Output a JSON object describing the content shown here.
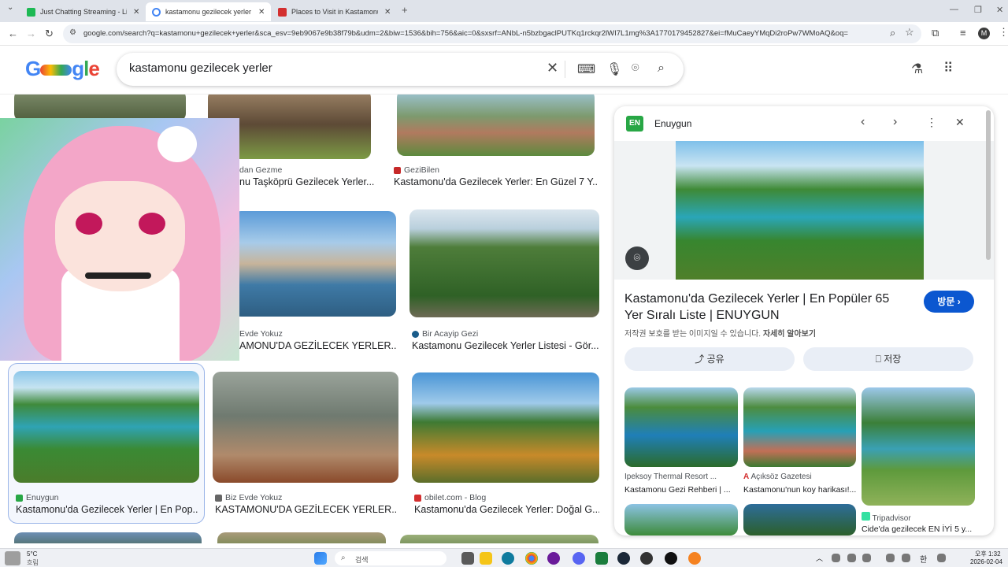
{
  "browser": {
    "tabs": [
      {
        "title": "Just Chatting Streaming - Live",
        "active": false,
        "color": "#1db954"
      },
      {
        "title": "kastamonu gezilecek yerler - Google",
        "active": true,
        "color": "#4285f4"
      },
      {
        "title": "Places to Visit in Kastamonu",
        "active": false,
        "color": "#d32f2f"
      }
    ],
    "new_tab": "+",
    "url": "google.com/search?q=kastamonu+gezilecek+yerler&sca_esv=9eb9067e9b38f79b&udm=2&biw=1536&bih=756&aic=0&sxsrf=ANbL-n5bzbgaclPUTKq1rckqr2lWI7L1mg%3A1770179452827&ei=fMuCaeyYMqDi2roPw7WMoAQ&oq="
  },
  "google": {
    "logo": "Google",
    "query": "kastamonu gezilecek yerler"
  },
  "results": [
    {
      "source": "dan Gezme",
      "caption": "nu Taşköprü Gezilecek Yerler..."
    },
    {
      "source": "GeziBilen",
      "caption": "Kastamonu'da Gezilecek Yerler: En Güzel 7 Y..."
    },
    {
      "source": "Evde Yokuz",
      "caption": "AMONU'DA GEZİLECEK YERLER..."
    },
    {
      "source": "Bir Acayip Gezi",
      "caption": "Kastamonu Gezilecek Yerler Listesi - Gör..."
    },
    {
      "source": "Enuygun",
      "caption": "Kastamonu'da Gezilecek Yerler | En Pop..."
    },
    {
      "source": "Biz Evde Yokuz",
      "caption": "KASTAMONU'DA GEZİLECEK YERLER..."
    },
    {
      "source": "obilet.com - Blog",
      "caption": "Kastamonu'da Gezilecek Yerler: Doğal G..."
    }
  ],
  "panel": {
    "source": "Enuygun",
    "source_badge": "EN",
    "title": "Kastamonu'da Gezilecek Yerler | En Popüler 65 Yer Sıralı Liste | ENUYGUN",
    "visit_label": "방문",
    "note": "저작권 보호를 받는 이미지일 수 있습니다.",
    "note_link": "자세히 알아보기",
    "share_label": "공유",
    "save_label": "저장",
    "related": [
      {
        "source": "Ipeksoy Thermal Resort ...",
        "caption": "Kastamonu Gezi Rehberi | ..."
      },
      {
        "source": "Açıksöz Gazetesi",
        "caption": "Kastamonu'nun koy harikası!..."
      },
      {
        "source": "Tripadvisor",
        "caption": "Cide'da gezilecek EN İYİ 5 y..."
      }
    ]
  },
  "taskbar": {
    "weather_temp": "5°C",
    "weather_desc": "흐림",
    "search_label": "검색",
    "time": "오후 1:32",
    "date": "2026-02-04",
    "ime": "한"
  }
}
